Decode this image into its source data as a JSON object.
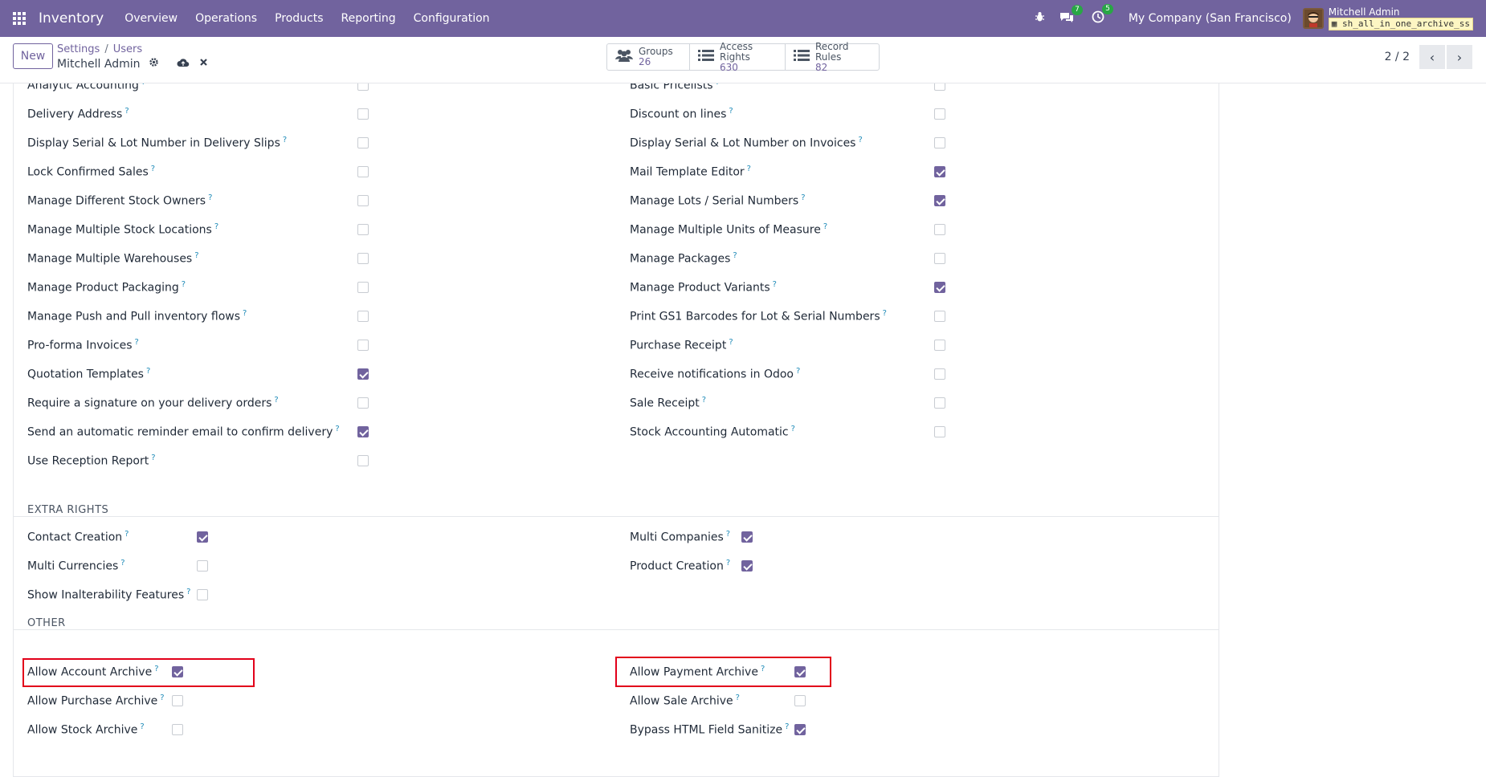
{
  "navbar": {
    "app_name": "Inventory",
    "menu": [
      "Overview",
      "Operations",
      "Products",
      "Reporting",
      "Configuration"
    ],
    "messages_badge": "7",
    "activities_badge": "5",
    "company": "My Company (San Francisco)",
    "user_name": "Mitchell Admin",
    "database": "sh_all_in_one_archive_ss"
  },
  "control_panel": {
    "new_label": "New",
    "breadcrumb": [
      "Settings",
      "Users"
    ],
    "record_name": "Mitchell Admin",
    "stats": [
      {
        "label": "Groups",
        "value": "26",
        "icon": "users-icon"
      },
      {
        "label": "Access Rights",
        "value": "630",
        "icon": "list-icon"
      },
      {
        "label": "Record Rules",
        "value": "82",
        "icon": "list-icon"
      }
    ],
    "pager": "2 / 2"
  },
  "technical_left": [
    {
      "label": "Analytic Accounting",
      "checked": false
    },
    {
      "label": "Delivery Address",
      "checked": false
    },
    {
      "label": "Display Serial & Lot Number in Delivery Slips",
      "checked": false
    },
    {
      "label": "Lock Confirmed Sales",
      "checked": false
    },
    {
      "label": "Manage Different Stock Owners",
      "checked": false
    },
    {
      "label": "Manage Multiple Stock Locations",
      "checked": false
    },
    {
      "label": "Manage Multiple Warehouses",
      "checked": false
    },
    {
      "label": "Manage Product Packaging",
      "checked": false
    },
    {
      "label": "Manage Push and Pull inventory flows",
      "checked": false
    },
    {
      "label": "Pro-forma Invoices",
      "checked": false
    },
    {
      "label": "Quotation Templates",
      "checked": true
    },
    {
      "label": "Require a signature on your delivery orders",
      "checked": false
    },
    {
      "label": "Send an automatic reminder email to confirm delivery",
      "checked": true
    },
    {
      "label": "Use Reception Report",
      "checked": false
    }
  ],
  "technical_right": [
    {
      "label": "Basic Pricelists",
      "checked": false
    },
    {
      "label": "Discount on lines",
      "checked": false
    },
    {
      "label": "Display Serial & Lot Number on Invoices",
      "checked": false
    },
    {
      "label": "Mail Template Editor",
      "checked": true
    },
    {
      "label": "Manage Lots / Serial Numbers",
      "checked": true
    },
    {
      "label": "Manage Multiple Units of Measure",
      "checked": false
    },
    {
      "label": "Manage Packages",
      "checked": false
    },
    {
      "label": "Manage Product Variants",
      "checked": true
    },
    {
      "label": "Print GS1 Barcodes for Lot & Serial Numbers",
      "checked": false
    },
    {
      "label": "Purchase Receipt",
      "checked": false
    },
    {
      "label": "Receive notifications in Odoo",
      "checked": false
    },
    {
      "label": "Sale Receipt",
      "checked": false
    },
    {
      "label": "Stock Accounting Automatic",
      "checked": false
    }
  ],
  "extra_rights": {
    "title": "EXTRA RIGHTS",
    "left": [
      {
        "label": "Contact Creation",
        "checked": true
      },
      {
        "label": "Multi Currencies",
        "checked": false
      },
      {
        "label": "Show Inalterability Features",
        "checked": false
      }
    ],
    "right": [
      {
        "label": "Multi Companies",
        "checked": true
      },
      {
        "label": "Product Creation",
        "checked": true
      }
    ]
  },
  "other": {
    "title": "OTHER",
    "left": [
      {
        "label": "Allow Account Archive",
        "checked": true
      },
      {
        "label": "Allow Purchase Archive",
        "checked": false
      },
      {
        "label": "Allow Stock Archive",
        "checked": false
      }
    ],
    "right": [
      {
        "label": "Allow Payment Archive",
        "checked": true
      },
      {
        "label": "Allow Sale Archive",
        "checked": false
      },
      {
        "label": "Bypass HTML Field Sanitize",
        "checked": true
      }
    ]
  },
  "help_marker": "?",
  "colors": {
    "brand": "#71639e",
    "highlight": "#e2001a",
    "badge": "#28a745"
  }
}
